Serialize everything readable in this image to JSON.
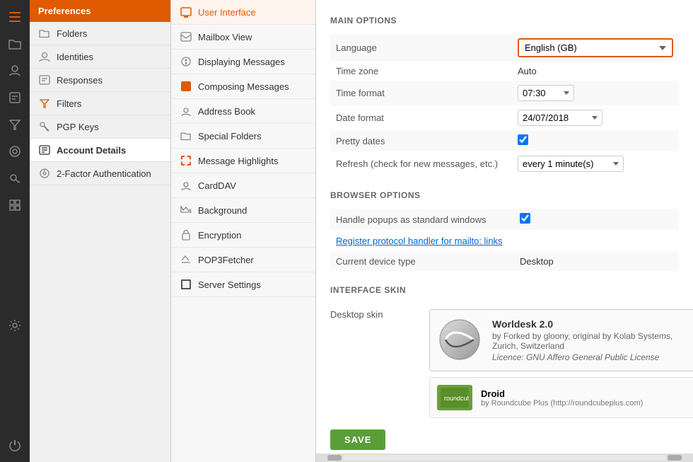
{
  "app": {
    "title": "Preferences"
  },
  "icon_rail": {
    "items": [
      {
        "name": "preferences-icon",
        "icon": "⚙",
        "label": "Preferences",
        "active": true
      },
      {
        "name": "folders-icon",
        "icon": "📁",
        "label": "Folders",
        "active": false
      },
      {
        "name": "user-icon",
        "icon": "👤",
        "label": "User",
        "active": false
      },
      {
        "name": "edit-icon",
        "icon": "✏",
        "label": "Edit",
        "active": false
      },
      {
        "name": "filter-icon",
        "icon": "🔺",
        "label": "Filter",
        "active": false
      },
      {
        "name": "security-icon",
        "icon": "⬡",
        "label": "Security",
        "active": false
      },
      {
        "name": "key-icon",
        "icon": "🔑",
        "label": "Keys",
        "active": false
      },
      {
        "name": "grid-icon",
        "icon": "▦",
        "label": "Grid",
        "active": false
      },
      {
        "name": "settings-cog-icon",
        "icon": "⚙",
        "label": "Settings",
        "active": false
      },
      {
        "name": "power-icon",
        "icon": "⏻",
        "label": "Power",
        "active": false,
        "bottom": true
      }
    ]
  },
  "nav": {
    "header": "Preferences",
    "items": [
      {
        "name": "user-interface",
        "label": "User Interface",
        "active": true
      },
      {
        "name": "mailbox-view",
        "label": "Mailbox View",
        "active": false
      },
      {
        "name": "displaying-messages",
        "label": "Displaying Messages",
        "active": false
      },
      {
        "name": "composing-messages",
        "label": "Composing Messages",
        "active": false
      },
      {
        "name": "address-book",
        "label": "Address Book",
        "active": false
      },
      {
        "name": "special-folders",
        "label": "Special Folders",
        "active": false
      },
      {
        "name": "message-highlights",
        "label": "Message Highlights",
        "active": false
      },
      {
        "name": "carddav",
        "label": "CardDAV",
        "active": false
      },
      {
        "name": "background",
        "label": "Background",
        "active": false
      },
      {
        "name": "encryption",
        "label": "Encryption",
        "active": false
      },
      {
        "name": "pop3fetcher",
        "label": "POP3Fetcher",
        "active": false
      },
      {
        "name": "server-settings",
        "label": "Server Settings",
        "active": false
      }
    ]
  },
  "left_nav": {
    "items": [
      {
        "name": "folders",
        "label": "Folders",
        "icon": "folder"
      },
      {
        "name": "identities",
        "label": "Identities",
        "icon": "person"
      },
      {
        "name": "responses",
        "label": "Responses",
        "icon": "edit"
      },
      {
        "name": "filters",
        "label": "Filters",
        "icon": "filter"
      },
      {
        "name": "pgp-keys",
        "label": "PGP Keys",
        "icon": "key"
      },
      {
        "name": "account-details",
        "label": "Account Details",
        "icon": "card",
        "active": true
      },
      {
        "name": "2fa",
        "label": "2-Factor Authentication",
        "icon": "cog"
      }
    ]
  },
  "main": {
    "main_options_title": "MAIN OPTIONS",
    "browser_options_title": "BROWSER OPTIONS",
    "interface_skin_title": "INTERFACE SKIN",
    "fields": {
      "language_label": "Language",
      "language_value": "English (GB)",
      "timezone_label": "Time zone",
      "timezone_value": "Auto",
      "time_format_label": "Time format",
      "time_format_value": "07:30",
      "date_format_label": "Date format",
      "date_format_value": "24/07/2018",
      "pretty_dates_label": "Pretty dates",
      "pretty_dates_checked": true,
      "refresh_label": "Refresh (check for new messages, etc.)",
      "refresh_value": "every 1 minute(s)",
      "handle_popups_label": "Handle popups as standard windows",
      "handle_popups_checked": true,
      "register_protocol_label": "Register protocol handler for mailto: links",
      "current_device_label": "Current device type",
      "current_device_value": "Desktop",
      "desktop_skin_label": "Desktop skin"
    },
    "skin": {
      "name": "Worldesk 2.0",
      "by": "by Forked by gloony, original by Kolab Systems, Zurich, Switzerland",
      "licence": "Licence: GNU Affero General Public License"
    },
    "droid_skin": {
      "name": "Droid",
      "by": "by Roundcube Plus (http://roundcubeplus.com)"
    },
    "save_button": "SAVE"
  }
}
